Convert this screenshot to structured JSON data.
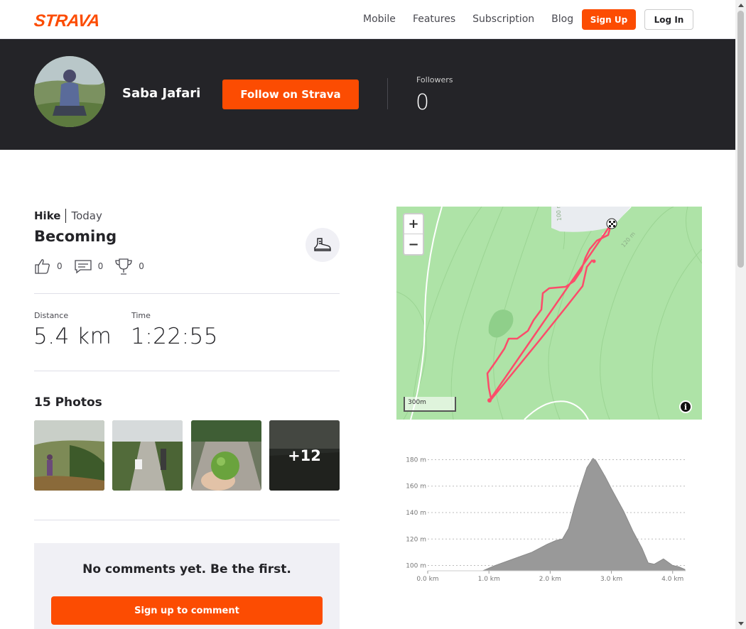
{
  "nav": {
    "logo": "STRAVA",
    "links": [
      "Mobile",
      "Features",
      "Subscription",
      "Blog"
    ],
    "signup": "Sign Up",
    "login": "Log In"
  },
  "athlete": {
    "name": "Saba Jafari",
    "follow": "Follow on Strava",
    "followers_label": "Followers",
    "followers_count": "0"
  },
  "activity": {
    "type": "Hike",
    "date": "Today",
    "title": "Becoming",
    "kudos": "0",
    "comments": "0",
    "achievements": "0",
    "stats": [
      {
        "label": "Distance",
        "value": "5.4 km"
      },
      {
        "label": "Time",
        "value": "1:22:55"
      }
    ]
  },
  "photos": {
    "title": "15 Photos",
    "more": "+12"
  },
  "comments": {
    "empty": "No comments yet. Be the first.",
    "signup": "Sign up to comment"
  },
  "map": {
    "zoom_in": "+",
    "zoom_out": "−",
    "scale": "300m",
    "info": "i",
    "contour_labels": [
      "100 m",
      "120 m"
    ],
    "colors": {
      "land": "#aee3a7",
      "route": "#fc4c6a"
    }
  },
  "chart_data": {
    "type": "area",
    "x_tick_labels": [
      "0.0 km",
      "1.0 km",
      "2.0 km",
      "3.0 km",
      "4.0 km"
    ],
    "y_tick_labels": [
      "100 m",
      "120 m",
      "140 m",
      "160 m",
      "180 m"
    ],
    "xlim": [
      0,
      4.2
    ],
    "ylim": [
      96,
      184
    ],
    "grid": true,
    "x": [
      0,
      0.5,
      0.9,
      1.1,
      1.4,
      1.7,
      1.95,
      2.05,
      2.1,
      2.2,
      2.3,
      2.4,
      2.5,
      2.6,
      2.7,
      2.75,
      2.8,
      2.9,
      3.0,
      3.2,
      3.35,
      3.5,
      3.6,
      3.7,
      3.85,
      4.0,
      4.1,
      4.2
    ],
    "y": [
      96,
      96,
      96,
      100,
      105,
      110,
      116,
      118,
      119,
      120,
      128,
      145,
      160,
      174,
      181,
      179,
      175,
      167,
      158,
      141,
      126,
      113,
      102,
      101,
      105,
      100,
      99,
      97
    ]
  }
}
